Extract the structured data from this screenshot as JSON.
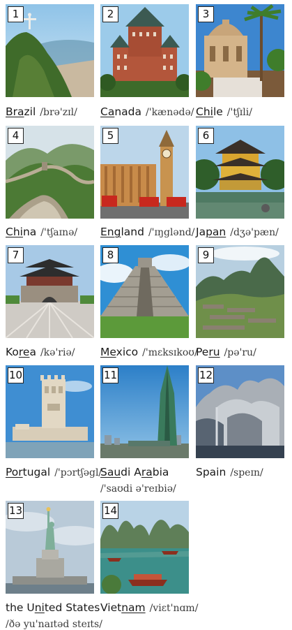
{
  "countries": [
    {
      "number": "1",
      "pre": "",
      "stress": "Bra",
      "post": "zil",
      "ipa": "/brə'zɪl/"
    },
    {
      "number": "2",
      "pre": "",
      "stress": "Ca",
      "post": "nada",
      "ipa": "/'kænədə/"
    },
    {
      "number": "3",
      "pre": "",
      "stress": "Chi",
      "post": "le",
      "ipa": "/'tʃɪli/"
    },
    {
      "number": "4",
      "pre": "",
      "stress": "Chi",
      "post": "na",
      "ipa": "/'tʃaɪnə/"
    },
    {
      "number": "5",
      "pre": "",
      "stress": "Eng",
      "post": "land",
      "ipa": "/'ɪŋglənd/"
    },
    {
      "number": "6",
      "pre": "Ja",
      "stress": "pan",
      "post": "",
      "ipa": "/dʒə'pæn/"
    },
    {
      "number": "7",
      "pre": "Ko",
      "stress": "re",
      "post": "a",
      "ipa": "/kə'riə/"
    },
    {
      "number": "8",
      "pre": "",
      "stress": "Me",
      "post": "xico",
      "ipa": "/'mɛksɪkoʊ/"
    },
    {
      "number": "9",
      "pre": "Pe",
      "stress": "ru",
      "post": "",
      "ipa": "/pə'ru/"
    },
    {
      "number": "10",
      "pre": "",
      "stress": "Por",
      "post": "tugal",
      "ipa": "/'pɔrtʃəgl/"
    },
    {
      "number": "11",
      "pre": "",
      "stress": "Sau",
      "post": "di A",
      "stress2": "ra",
      "post2": "bia",
      "ipa": "/'saʊdi ə'reɪbiə/"
    },
    {
      "number": "12",
      "pre": "Spain",
      "stress": "",
      "post": "",
      "ipa": "/speɪn/"
    },
    {
      "number": "13",
      "pre": "the U",
      "stress": "ni",
      "post": "ted States",
      "ipa": "/ðə yu'naɪtəd steɪts/"
    },
    {
      "number": "14",
      "pre": "Viet",
      "stress": "nam",
      "post": "",
      "ipa": "/viɛt'nɑm/"
    }
  ]
}
